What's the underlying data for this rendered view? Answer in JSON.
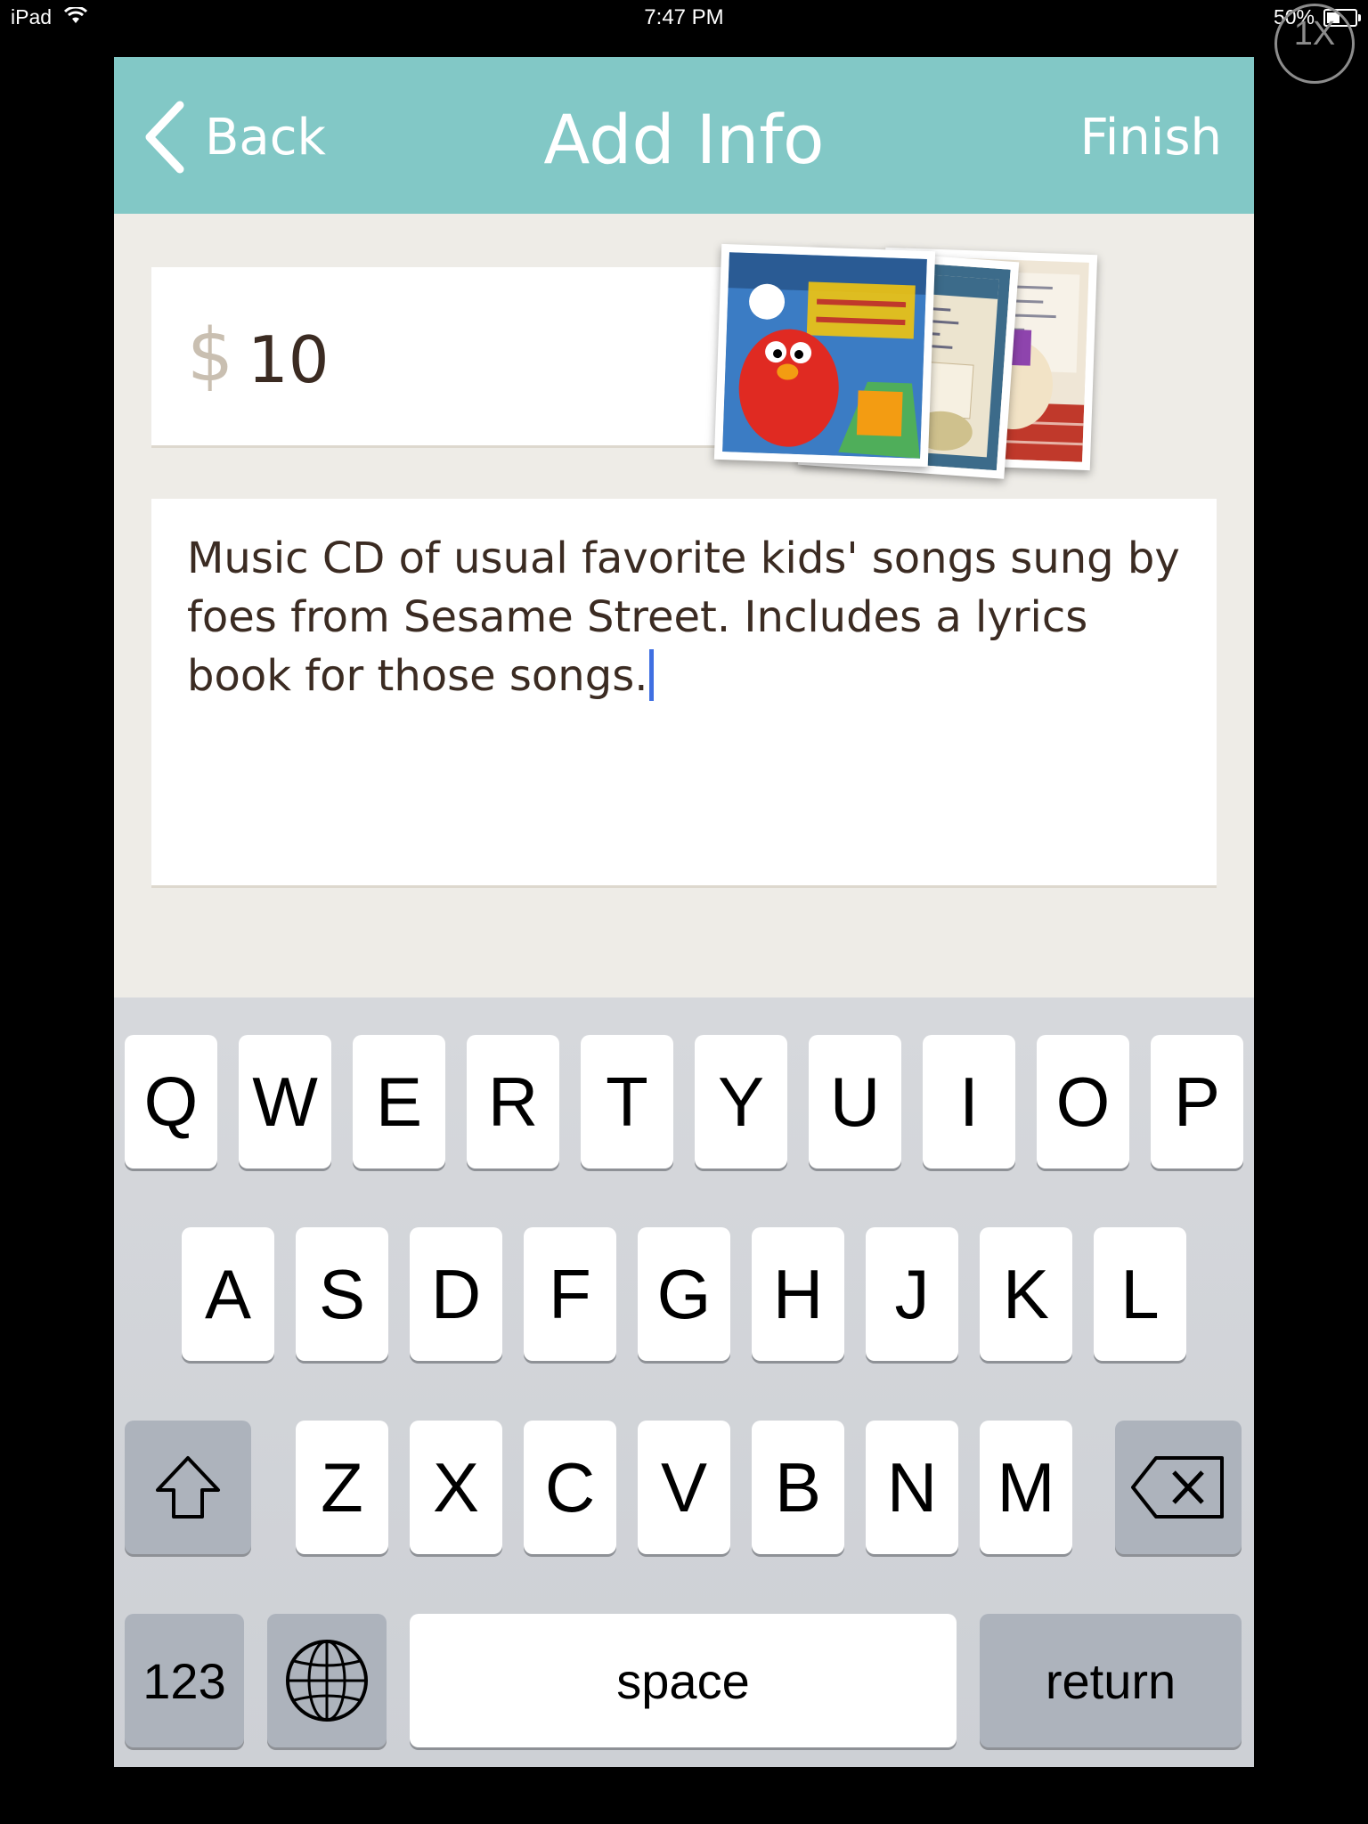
{
  "status_bar": {
    "device": "iPad",
    "time": "7:47 PM",
    "battery": "50%",
    "battery_level": 0.5
  },
  "zoom_badge": "1X",
  "nav": {
    "back_label": "Back",
    "title": "Add Info",
    "finish_label": "Finish"
  },
  "price": {
    "currency": "$",
    "value": "10"
  },
  "description": {
    "text": "Music CD of usual favorite kids' songs sung by foes from Sesame Street.  Includes a lyrics book for those songs."
  },
  "keyboard": {
    "row1": [
      "Q",
      "W",
      "E",
      "R",
      "T",
      "Y",
      "U",
      "I",
      "O",
      "P"
    ],
    "row2": [
      "A",
      "S",
      "D",
      "F",
      "G",
      "H",
      "J",
      "K",
      "L"
    ],
    "row3": [
      "Z",
      "X",
      "C",
      "V",
      "B",
      "N",
      "M"
    ],
    "numbers_label": "123",
    "space_label": "space",
    "return_label": "return"
  },
  "colors": {
    "nav_bar": "#82c8c6",
    "background": "#eeece7",
    "caret": "#3f6fe2"
  }
}
